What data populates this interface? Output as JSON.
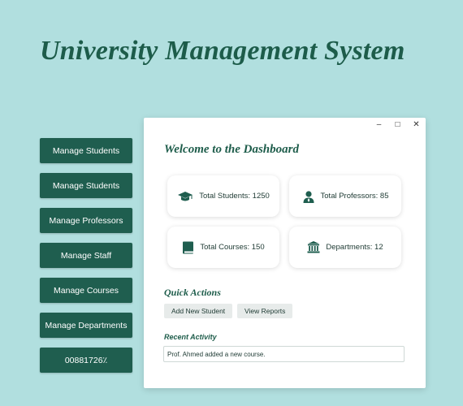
{
  "app": {
    "title": "University Management System"
  },
  "sidebar": {
    "items": [
      {
        "label": "Manage Students"
      },
      {
        "label": "Manage Students"
      },
      {
        "label": "Manage Professors"
      },
      {
        "label": "Manage Staff"
      },
      {
        "label": "Manage Courses"
      },
      {
        "label": "Manage Departments"
      },
      {
        "label": "00881726٪"
      }
    ]
  },
  "window": {
    "controls": {
      "minimize": "–",
      "maximize": "□",
      "close": "✕"
    }
  },
  "dashboard": {
    "welcome": "Welcome to the Dashboard",
    "cards": [
      {
        "label": "Total Students: 1250",
        "icon": "graduation-cap-icon"
      },
      {
        "label": "Total Professors: 85",
        "icon": "professor-icon"
      },
      {
        "label": "Total Courses: 150",
        "icon": "book-icon"
      },
      {
        "label": "Departments: 12",
        "icon": "building-icon"
      }
    ],
    "quick_actions": {
      "title": "Quick Actions",
      "buttons": [
        {
          "label": "Add New Student"
        },
        {
          "label": "View Reports"
        }
      ]
    },
    "recent_activity": {
      "title": "Recent Activity",
      "items": [
        "Prof. Ahmed added a new course."
      ]
    }
  },
  "colors": {
    "background": "#b1dfdf",
    "accent": "#1f5e4f",
    "title": "#1d5c4a",
    "panel": "#ffffff"
  }
}
